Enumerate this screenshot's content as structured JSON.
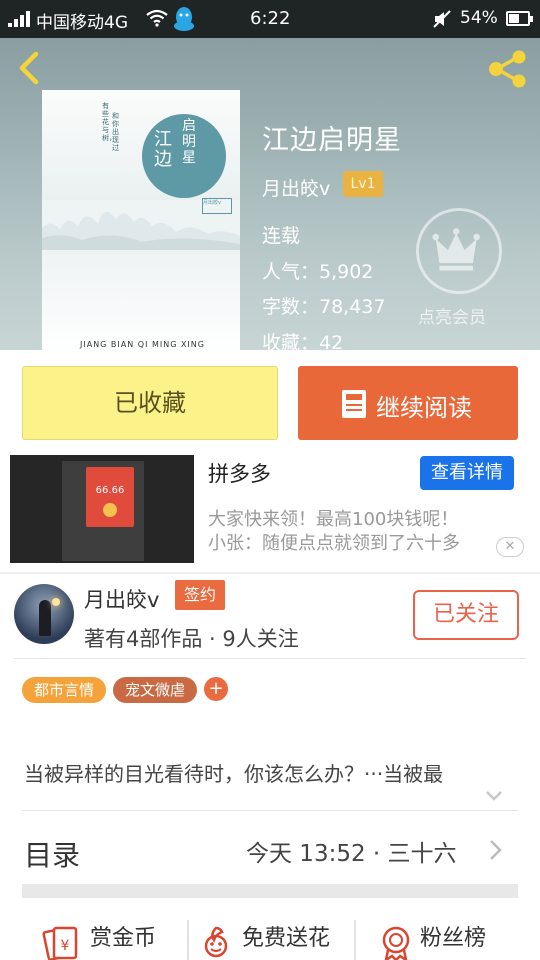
{
  "status_bar": {
    "carrier": "中国移动4G",
    "time": "6:22",
    "battery": "54%",
    "battery_level": 0.54
  },
  "book": {
    "title": "江边启明星",
    "author": "月出皎v",
    "level": "Lv1",
    "status": "连载",
    "popularity": "人气：5,902",
    "word_count": "字数：78,437",
    "favorites": "收藏：42",
    "vip_label": "点亮会员"
  },
  "cover": {
    "title_line1": "江边",
    "title_line2": "启明星",
    "pinyin": "JIANG BIAN QI MING XING",
    "blurb_a": "有些花与树，",
    "blurb_b": "和你出现过",
    "stamp": "月出皎v"
  },
  "actions": {
    "collected_label": "已收藏",
    "read_label": "继续阅读"
  },
  "ad": {
    "title": "拼多多",
    "button": "查看详情",
    "line1": "大家快来领！最高100块钱呢！",
    "line2": "小张：随便点点就领到了六十多",
    "close": "✕",
    "amount": "66.66"
  },
  "author": {
    "name": "月出皎v",
    "badge": "签约",
    "stats": "著有4部作品 · 9人关注",
    "follow": "已关注"
  },
  "tags": [
    "都市言情",
    "宠文微虐"
  ],
  "tag_add": "+",
  "synopsis": "当被异样的目光看待时，你该怎么办？···当被最",
  "toc": {
    "title": "目录",
    "latest": "今天 13:52 · 三十六"
  },
  "bottom": {
    "reward": "赏金币",
    "flower": "免费送花",
    "fans": "粉丝榜"
  },
  "colors": {
    "accent_orange": "#e8683a",
    "collected_yellow": "#fbf28a",
    "ad_blue": "#1a73e8",
    "level_gold": "#e9b241"
  }
}
